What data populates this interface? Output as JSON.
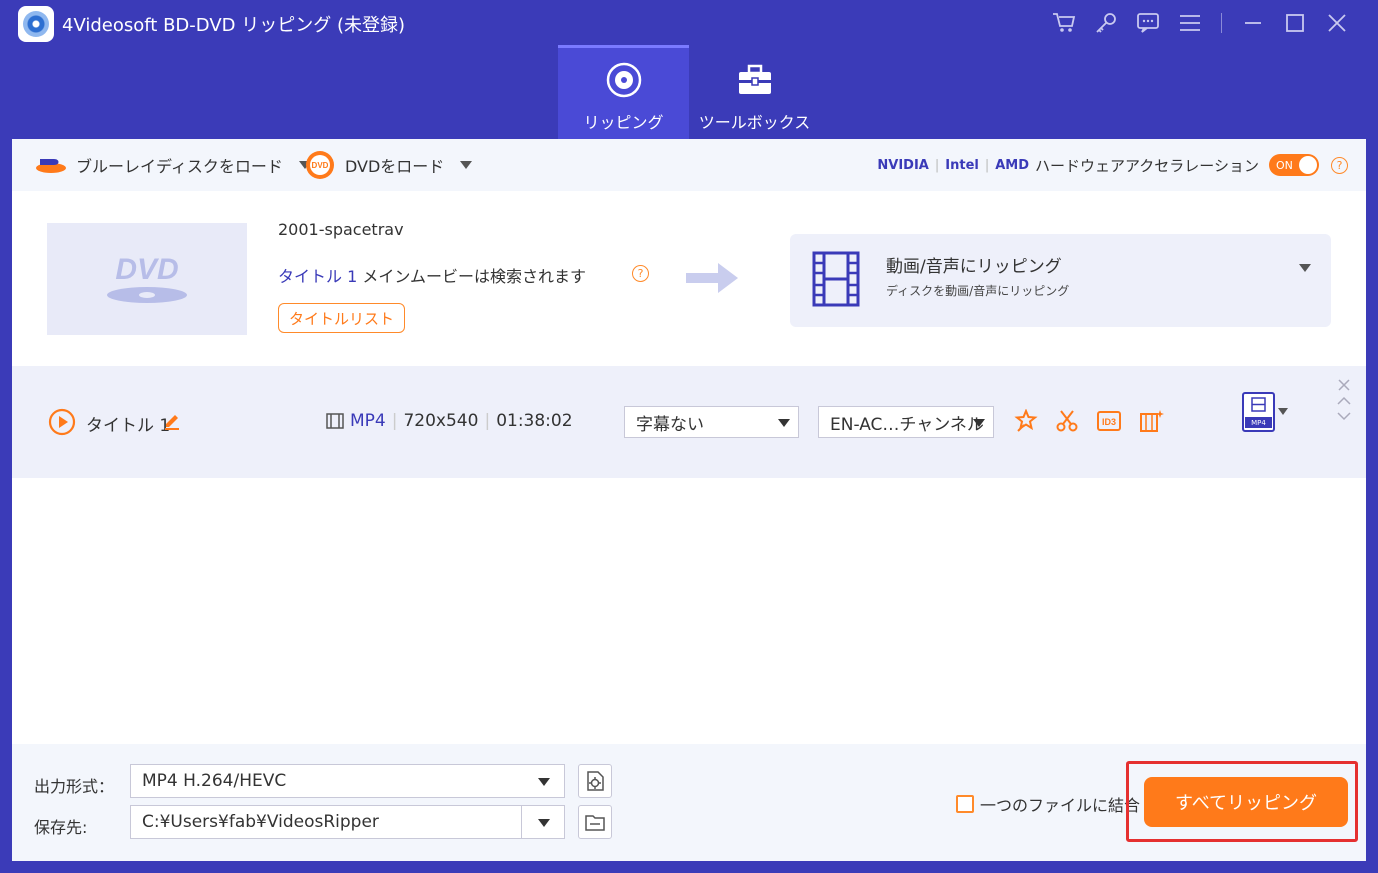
{
  "app": {
    "title": "4Videosoft BD-DVD リッピング (未登録)",
    "icons": [
      "cart-icon",
      "key-icon",
      "chat-icon",
      "menu-icon",
      "minimize-icon",
      "maximize-icon",
      "close-icon"
    ]
  },
  "tabs": [
    {
      "label": "リッピング",
      "active": true
    },
    {
      "label": "ツールボックス",
      "active": false
    }
  ],
  "toolbar": {
    "load_bd": "ブルーレイディスクをロード",
    "load_dvd": "DVDをロード",
    "vendor_nvidia": "NVIDIA",
    "vendor_intel": "Intel",
    "vendor_amd": "AMD",
    "hw_accel": "ハードウェアアクセラレーション",
    "toggle": "ON"
  },
  "source": {
    "name": "2001-spacetrav",
    "title_prefix": "タイトル 1",
    "title_suffix": " メインムービーは検索されます",
    "title_list_button": "タイトルリスト"
  },
  "target": {
    "title": "動画/音声にリッピング",
    "subtitle": "ディスクを動画/音声にリッピング"
  },
  "row": {
    "name": "タイトル 1",
    "format": "MP4",
    "resolution": "720x540",
    "duration": "01:38:02",
    "subtitle_select": "字幕ない",
    "audio_select": "EN-AC…チャンネル",
    "output_badge": "MP4"
  },
  "bottom": {
    "output_format_label": "出力形式：",
    "output_format_value": "MP4 H.264/HEVC",
    "save_to_label": "保存先:",
    "save_to_value": "C:¥Users¥fab¥VideosRipper",
    "merge_label": "一つのファイルに結合",
    "rip_all_button": "すべてリッピング"
  },
  "colors": {
    "frame": "#3b3bb8",
    "accent": "#ff7a1a",
    "highlight": "#e53030"
  }
}
